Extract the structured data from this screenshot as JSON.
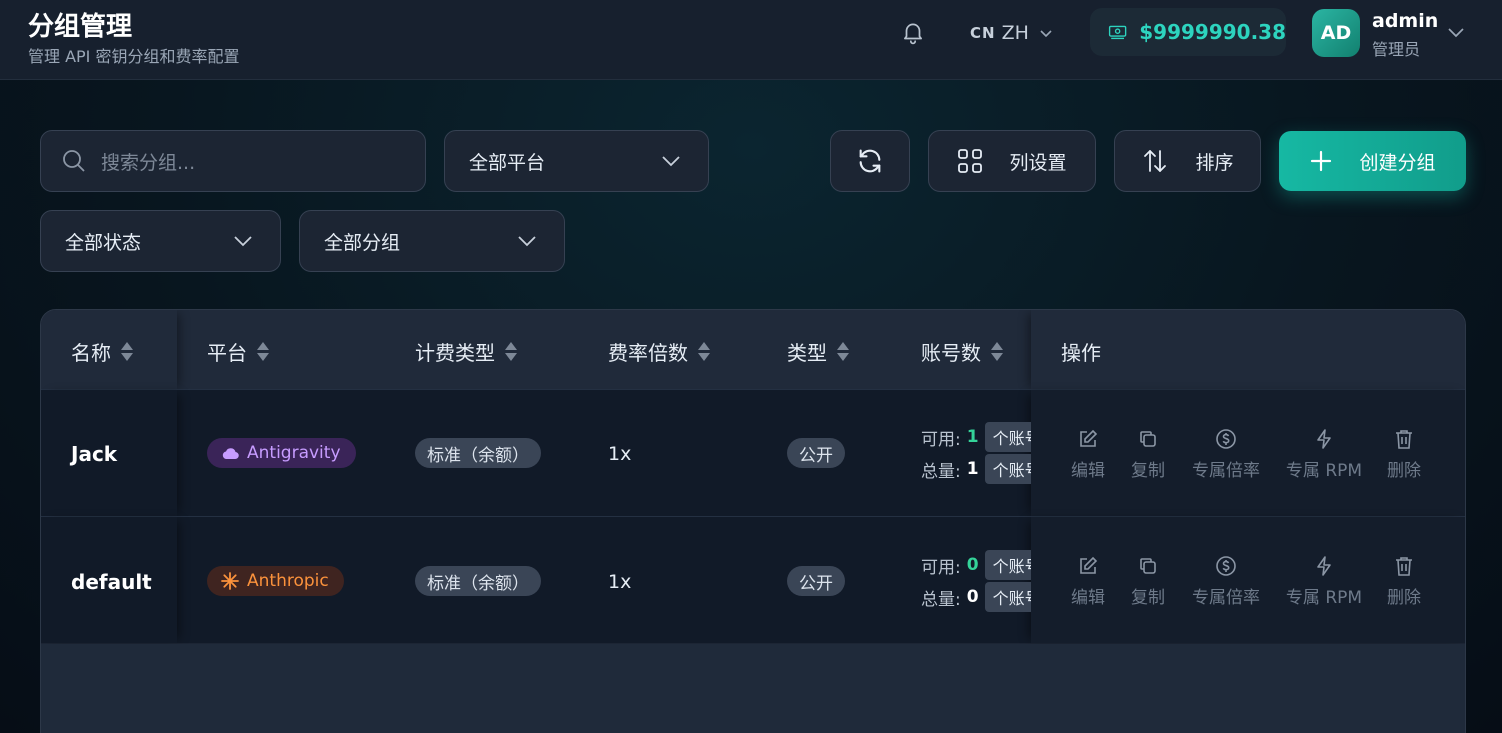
{
  "header": {
    "title": "分组管理",
    "subtitle": "管理 API 密钥分组和费率配置",
    "lang_code": "CN",
    "lang_label": "ZH",
    "balance": "$9999990.38",
    "avatar_initials": "AD",
    "user_name": "admin",
    "user_role": "管理员"
  },
  "toolbar": {
    "search_placeholder": "搜索分组...",
    "platform_filter": "全部平台",
    "status_filter": "全部状态",
    "group_filter": "全部分组",
    "columns_label": "列设置",
    "sort_label": "排序",
    "create_label": "创建分组"
  },
  "table": {
    "headers": {
      "name": "名称",
      "platform": "平台",
      "billing": "计费类型",
      "rate": "费率倍数",
      "type": "类型",
      "accounts": "账号数",
      "actions": "操作"
    },
    "rows": [
      {
        "name": "Jack",
        "platform": "Antigravity",
        "billing": "标准（余额）",
        "rate": "1x",
        "type": "公开",
        "available_label": "可用:",
        "available": "1",
        "total_label": "总量:",
        "total": "1",
        "acc_unit": "个账号"
      },
      {
        "name": "default",
        "platform": "Anthropic",
        "billing": "标准（余额）",
        "rate": "1x",
        "type": "公开",
        "available_label": "可用:",
        "available": "0",
        "total_label": "总量:",
        "total": "0",
        "acc_unit": "个账号"
      }
    ],
    "actions": {
      "edit": "编辑",
      "copy": "复制",
      "rate": "专属倍率",
      "rpm": "专属 RPM",
      "delete": "删除"
    }
  },
  "colors": {
    "accent": "#14b8a6",
    "antigravity": "#c79cff",
    "anthropic": "#fb923c",
    "available_green": "#34d399"
  }
}
